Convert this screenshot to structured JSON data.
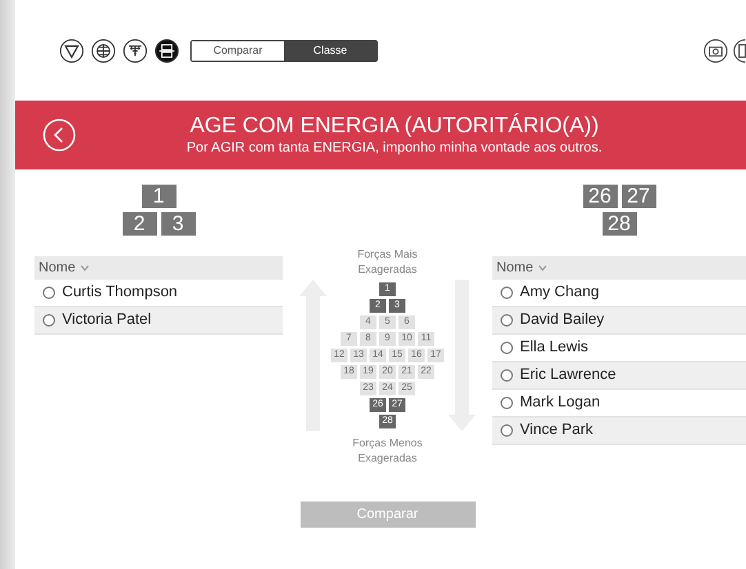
{
  "toolbar": [
    {
      "selected": false
    },
    {
      "selected": false
    },
    {
      "selected": false
    },
    {
      "selected": true
    }
  ],
  "view_toggle": [
    {
      "label": "Comparar",
      "selected": false
    },
    {
      "label": "Classe",
      "selected": true
    }
  ],
  "banner": {
    "title": "AGE COM ENERGIA (AUTORITÁRIO(A))",
    "subtitle": "Por AGIR com tanta ENERGIA, imponho minha vontade aos outros."
  },
  "left": {
    "ranks": [
      [
        "1"
      ],
      [
        "2",
        "3"
      ]
    ],
    "column": "Nome",
    "rows": [
      {
        "name": "Curtis Thompson",
        "selected": false
      },
      {
        "name": "Victoria Patel",
        "selected": false
      }
    ]
  },
  "pyramid": {
    "top_label": "Forças Mais Exageradas",
    "bottom_label": "Forças Menos Exageradas",
    "rows": [
      [
        {
          "label": "1",
          "selected": true
        }
      ],
      [
        {
          "label": "2",
          "selected": true
        },
        {
          "label": "3",
          "selected": true
        }
      ],
      [
        {
          "label": "4",
          "selected": false
        },
        {
          "label": "5",
          "selected": false
        },
        {
          "label": "6",
          "selected": false
        }
      ],
      [
        {
          "label": "7",
          "selected": false
        },
        {
          "label": "8",
          "selected": false
        },
        {
          "label": "9",
          "selected": false
        },
        {
          "label": "10",
          "selected": false
        },
        {
          "label": "11",
          "selected": false
        }
      ],
      [
        {
          "label": "12",
          "selected": false
        },
        {
          "label": "13",
          "selected": false
        },
        {
          "label": "14",
          "selected": false
        },
        {
          "label": "15",
          "selected": false
        },
        {
          "label": "16",
          "selected": false
        },
        {
          "label": "17",
          "selected": false
        }
      ],
      [
        {
          "label": "18",
          "selected": false
        },
        {
          "label": "19",
          "selected": false
        },
        {
          "label": "20",
          "selected": false
        },
        {
          "label": "21",
          "selected": false
        },
        {
          "label": "22",
          "selected": false
        }
      ],
      [
        {
          "label": "23",
          "selected": false
        },
        {
          "label": "24",
          "selected": false
        },
        {
          "label": "25",
          "selected": false
        }
      ],
      [
        {
          "label": "26",
          "selected": true
        },
        {
          "label": "27",
          "selected": true
        }
      ],
      [
        {
          "label": "28",
          "selected": true
        }
      ]
    ]
  },
  "right": {
    "ranks": [
      [
        "26",
        "27"
      ],
      [
        "28"
      ]
    ],
    "column": "Nome",
    "rows": [
      {
        "name": "Amy Chang",
        "selected": false
      },
      {
        "name": "David Bailey",
        "selected": false
      },
      {
        "name": "Ella Lewis",
        "selected": false
      },
      {
        "name": "Eric Lawrence",
        "selected": false
      },
      {
        "name": "Mark Logan",
        "selected": false
      },
      {
        "name": "Vince Park",
        "selected": false
      }
    ]
  },
  "compare_button": "Comparar"
}
